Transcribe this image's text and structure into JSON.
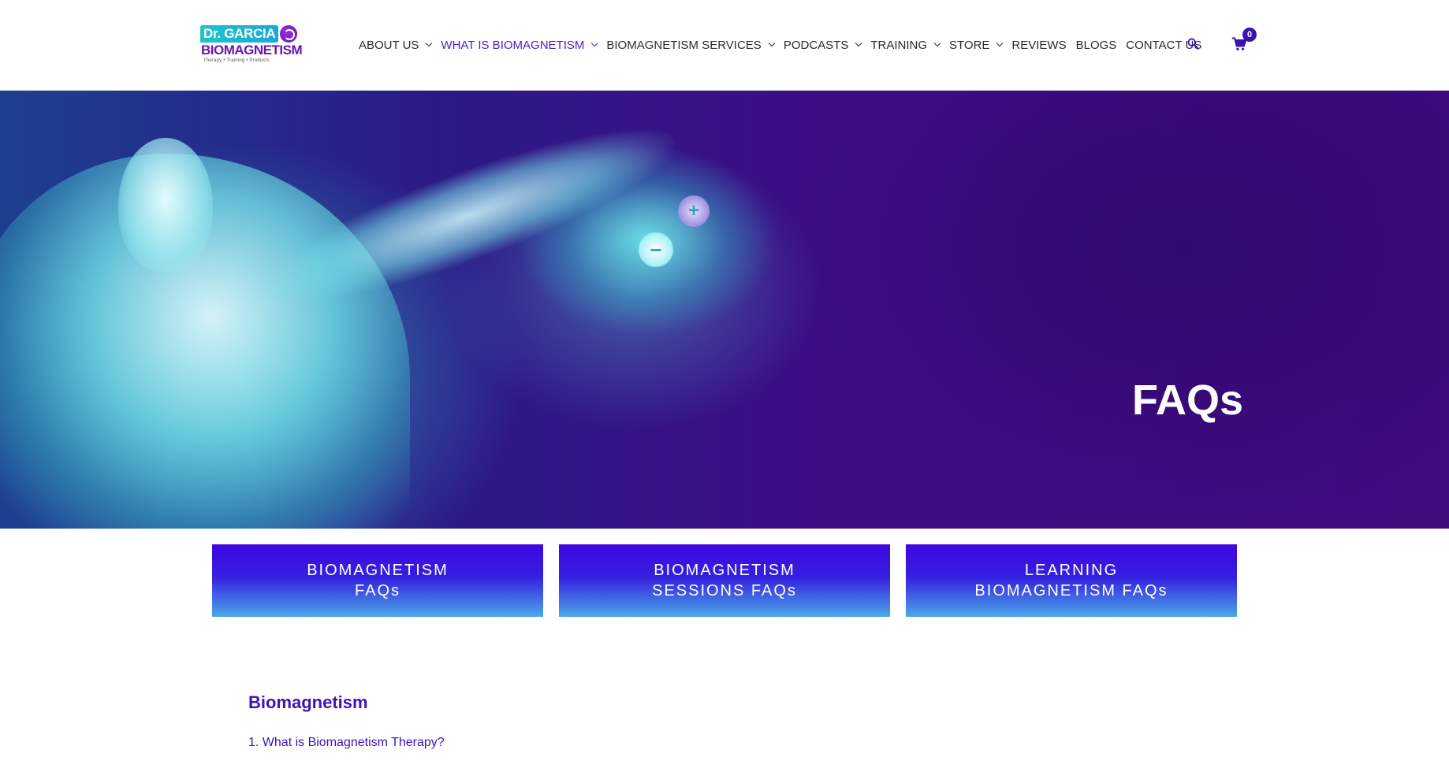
{
  "logo": {
    "line1": "Dr. GARCIA",
    "line2": "BIOMAGNETISM",
    "tagline": "Therapy • Training • Products"
  },
  "nav": {
    "items": [
      {
        "label": "ABOUT US",
        "has_dropdown": true,
        "active": false
      },
      {
        "label": "WHAT IS BIOMAGNETISM",
        "has_dropdown": true,
        "active": true
      },
      {
        "label": "BIOMAGNETISM SERVICES",
        "has_dropdown": true,
        "active": false
      },
      {
        "label": "PODCASTS",
        "has_dropdown": true,
        "active": false
      },
      {
        "label": "TRAINING",
        "has_dropdown": true,
        "active": false
      },
      {
        "label": "STORE",
        "has_dropdown": true,
        "active": false
      },
      {
        "label": "REVIEWS",
        "has_dropdown": false,
        "active": false
      },
      {
        "label": "BLOGS",
        "has_dropdown": false,
        "active": false
      },
      {
        "label": "CONTACT US",
        "has_dropdown": false,
        "active": false
      }
    ],
    "search_icon": "search-icon",
    "cart_icon": "cart-icon",
    "cart_count": "0"
  },
  "hero": {
    "title": "FAQs",
    "orb_plus": "+",
    "orb_minus": "−"
  },
  "faq_buttons": [
    {
      "line1": "BIOMAGNETISM",
      "line2": "FAQs"
    },
    {
      "line1": "BIOMAGNETISM",
      "line2": "SESSIONS FAQs"
    },
    {
      "line1": "LEARNING",
      "line2": "BIOMAGNETISM FAQs"
    }
  ],
  "content": {
    "section_title": "Biomagnetism",
    "first_question": "1. What is Biomagnetism Therapy?"
  },
  "colors": {
    "accent": "#3d14b5",
    "nav_active": "#4a1fbf",
    "cart_badge": "#3a12b0"
  }
}
